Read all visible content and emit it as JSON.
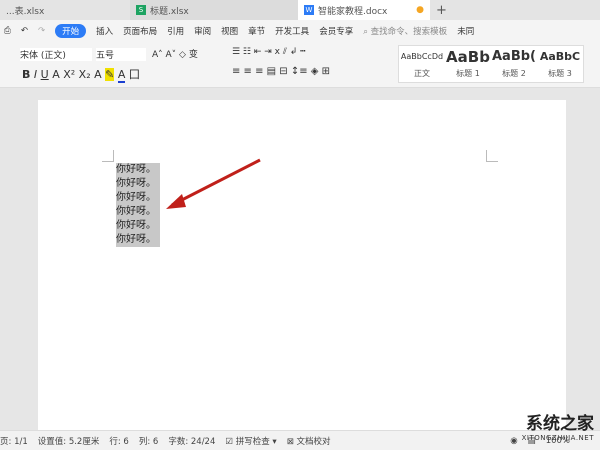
{
  "tabs": [
    {
      "label": "...表.xlsx",
      "icon": "spreadsheet-icon"
    },
    {
      "label": "标题.xlsx",
      "icon": "spreadsheet-icon"
    },
    {
      "label": "智能家教程.docx",
      "icon": "document-icon",
      "active": true
    }
  ],
  "menu": {
    "items": [
      "开始",
      "插入",
      "页面布局",
      "引用",
      "审阅",
      "视图",
      "章节",
      "开发工具",
      "会员专享"
    ],
    "search_placeholder": "查找命令、搜索模板",
    "cloud": "未同"
  },
  "ribbon": {
    "font": "宋体 (正文)",
    "size": "五号",
    "styles": [
      {
        "preview": "AaBbCcDd",
        "name": "正文"
      },
      {
        "preview": "AaBb",
        "name": "标题 1"
      },
      {
        "preview": "AaBb(",
        "name": "标题 2"
      },
      {
        "preview": "AaBbC",
        "name": "标题 3"
      }
    ]
  },
  "document": {
    "lines": [
      "你好呀。",
      "你好呀。",
      "你好呀。",
      "你好呀。",
      "你好呀。",
      "你好呀。"
    ],
    "arrow_color": "#c0201a"
  },
  "status": {
    "page": "页: 1/1",
    "setting": "设置值: 5.2厘米",
    "row": "行: 6",
    "col": "列: 6",
    "words": "字数: 24/24",
    "spell": "拼写检查",
    "proof": "文档校对",
    "zoom": "100%"
  },
  "watermark": {
    "title": "系统之家",
    "url": "XITONGZHIJIA.NET"
  }
}
